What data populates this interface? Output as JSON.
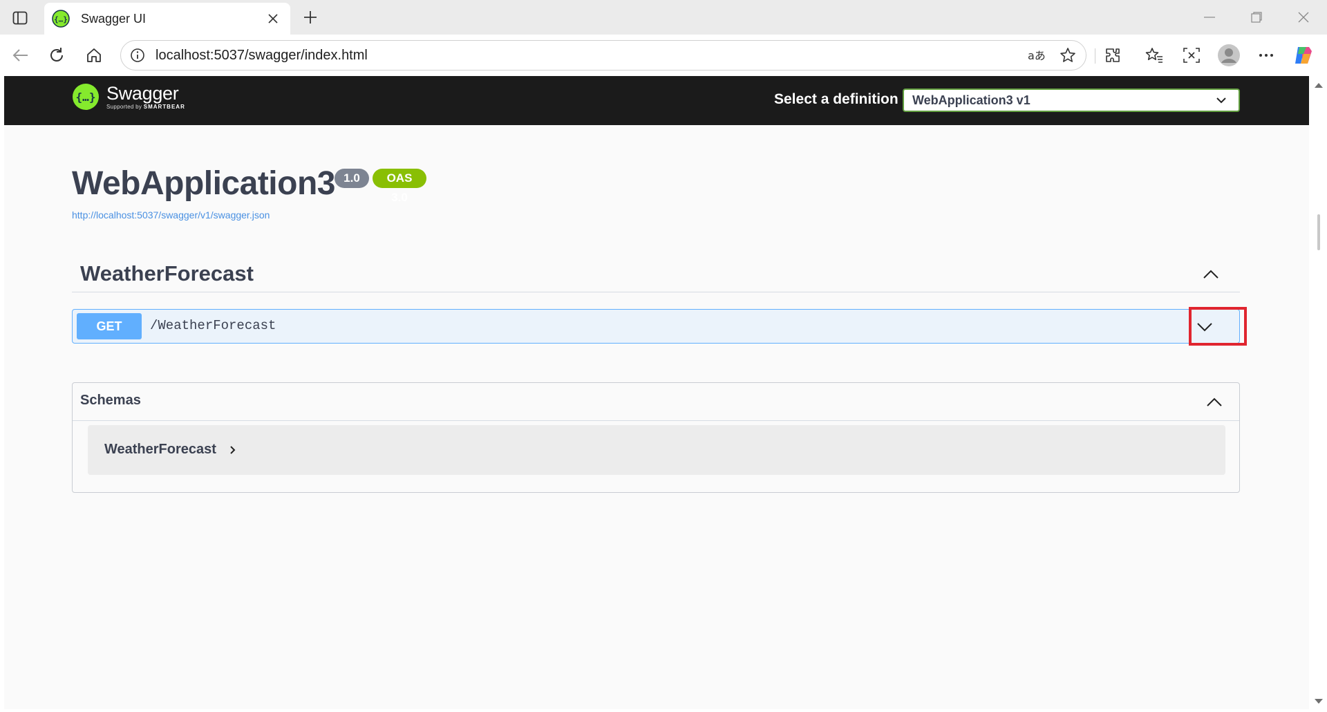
{
  "browser": {
    "tab_title": "Swagger UI",
    "url": "localhost:5037/swagger/index.html"
  },
  "swagger": {
    "logo_name": "Swagger",
    "logo_supported_by": "Supported by",
    "logo_brand": "SMARTBEAR",
    "select_label": "Select a definition",
    "selected_definition": "WebApplication3 v1",
    "accent_color": "#62a03f"
  },
  "info": {
    "title": "WebApplication3",
    "version": "1.0",
    "oas_version": "OAS 3.0",
    "spec_url": "http://localhost:5037/swagger/v1/swagger.json"
  },
  "tag": {
    "name": "WeatherForecast",
    "operations": [
      {
        "method": "GET",
        "path": "/WeatherForecast",
        "method_color": "#61affe"
      }
    ]
  },
  "schemas": {
    "title": "Schemas",
    "models": [
      {
        "name": "WeatherForecast"
      }
    ]
  },
  "icons": {
    "tab_actions": "tab-actions-icon",
    "favicon": "swagger-favicon-icon",
    "close": "close-icon",
    "new_tab": "plus-icon",
    "back": "back-arrow-icon",
    "refresh": "refresh-icon",
    "home": "home-icon",
    "info": "info-icon",
    "read_aloud": "translate-icon",
    "favorite": "star-icon",
    "extensions": "puzzle-icon",
    "favorites": "favorites-icon",
    "screenshot": "screenshot-icon",
    "profile": "avatar-icon",
    "more": "more-icon",
    "copilot": "copilot-icon",
    "chevron_up": "chevron-up-icon",
    "chevron_down": "chevron-down-icon"
  }
}
